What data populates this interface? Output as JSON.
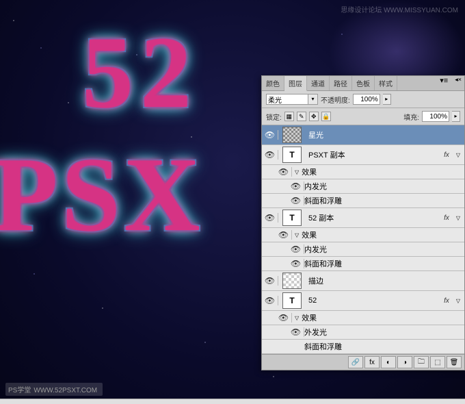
{
  "canvas": {
    "text_top": "52",
    "text_bottom": "PSX"
  },
  "watermark": {
    "top_brand": "思缘设计论坛",
    "top_url": "WWW.MISSYUAN.COM",
    "bottom_brand": "PS学堂",
    "bottom_url": "WWW.52PSXT.COM"
  },
  "panel": {
    "tabs": [
      "颜色",
      "图层",
      "通道",
      "路径",
      "色板",
      "样式"
    ],
    "active_tab": "图层",
    "blend_mode": "柔光",
    "opacity_label": "不透明度:",
    "opacity_value": "100%",
    "lock_label": "锁定:",
    "fill_label": "填充:",
    "fill_value": "100%"
  },
  "layers": [
    {
      "name": "星光",
      "thumb": "starlight",
      "selected": true
    },
    {
      "name": "PSXT 副本",
      "thumb": "T",
      "fx": true,
      "effects_label": "效果",
      "effects": [
        "内发光",
        "斜面和浮雕"
      ]
    },
    {
      "name": "52 副本",
      "thumb": "T",
      "fx": true,
      "effects_label": "效果",
      "effects": [
        "内发光",
        "斜面和浮雕"
      ]
    },
    {
      "name": "描边",
      "thumb": "checker"
    },
    {
      "name": "52",
      "thumb": "T",
      "fx": true,
      "effects_label": "效果",
      "effects": [
        "外发光",
        "斜面和浮雕"
      ]
    }
  ]
}
